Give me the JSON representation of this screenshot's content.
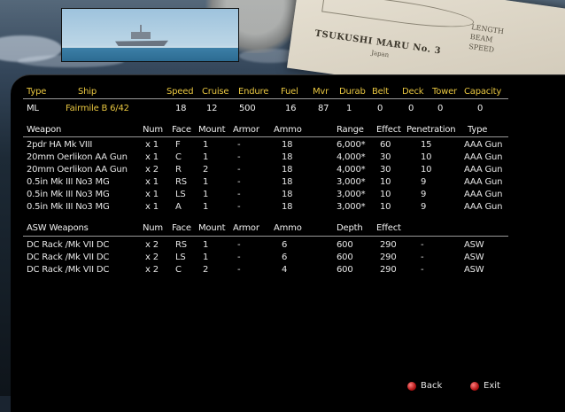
{
  "background": {
    "paper_title": "TSUKUSHI MARU No. 3",
    "paper_sub": "Japan",
    "paper_specs": [
      "LENGTH",
      "BEAM",
      "SPEED"
    ]
  },
  "ship_header": {
    "labels": [
      "Type",
      "Ship",
      "Speed",
      "Cruise",
      "Endure",
      "Fuel",
      "Mvr",
      "Durab",
      "Belt",
      "Deck",
      "Tower",
      "Capacity"
    ],
    "values": [
      "ML",
      "Fairmile B 6/42",
      "18",
      "12",
      "500",
      "16",
      "87",
      "1",
      "0",
      "0",
      "0",
      "0"
    ]
  },
  "weapons": {
    "headers": [
      "Weapon",
      "Num",
      "Face",
      "Mount",
      "Armor",
      "Ammo",
      "Range",
      "Effect",
      "Penetration",
      "Type"
    ],
    "rows": [
      [
        "2pdr HA Mk VIII",
        "x 1",
        "F",
        "1",
        "-",
        "18",
        "6,000*",
        "60",
        "15",
        "AAA Gun"
      ],
      [
        "20mm Oerlikon AA Gun",
        "x 1",
        "C",
        "1",
        "-",
        "18",
        "4,000*",
        "30",
        "10",
        "AAA Gun"
      ],
      [
        "20mm Oerlikon AA Gun",
        "x 2",
        "R",
        "2",
        "-",
        "18",
        "4,000*",
        "30",
        "10",
        "AAA Gun"
      ],
      [
        "0.5in Mk III No3 MG",
        "x 1",
        "RS",
        "1",
        "-",
        "18",
        "3,000*",
        "10",
        "9",
        "AAA Gun"
      ],
      [
        "0.5in Mk III No3 MG",
        "x 1",
        "LS",
        "1",
        "-",
        "18",
        "3,000*",
        "10",
        "9",
        "AAA Gun"
      ],
      [
        "0.5in Mk III No3 MG",
        "x 1",
        "A",
        "1",
        "-",
        "18",
        "3,000*",
        "10",
        "9",
        "AAA Gun"
      ]
    ]
  },
  "asw": {
    "headers": [
      "ASW Weapons",
      "Num",
      "Face",
      "Mount",
      "Armor",
      "Ammo",
      "Depth",
      "Effect"
    ],
    "rows": [
      [
        "DC Rack /Mk VII DC",
        "x 2",
        "RS",
        "1",
        "-",
        "6",
        "600",
        "290",
        "-",
        "ASW"
      ],
      [
        "DC Rack /Mk VII DC",
        "x 2",
        "LS",
        "1",
        "-",
        "6",
        "600",
        "290",
        "-",
        "ASW"
      ],
      [
        "DC Rack /Mk VII DC",
        "x 2",
        "C",
        "2",
        "-",
        "4",
        "600",
        "290",
        "-",
        "ASW"
      ]
    ]
  },
  "buttons": {
    "back": "Back",
    "exit": "Exit"
  },
  "colors": {
    "header_text": "#e8c640",
    "body_text": "#e6e6e6",
    "button": "#c81818"
  }
}
